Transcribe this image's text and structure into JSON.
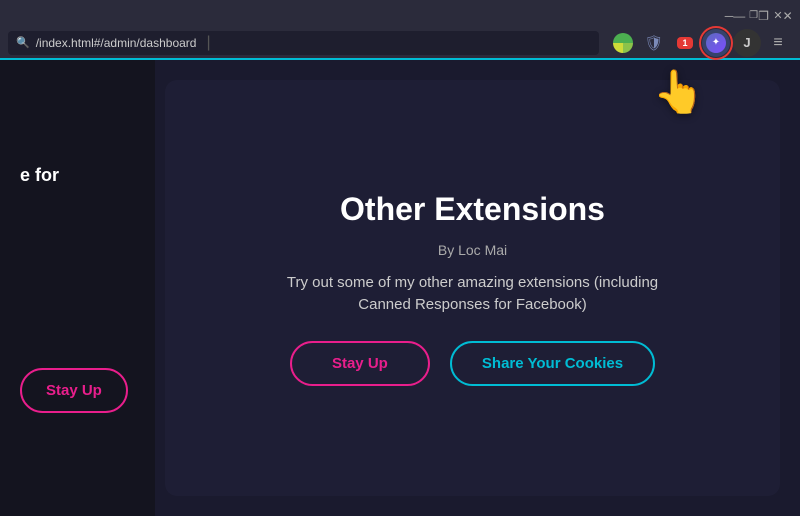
{
  "browser": {
    "address": "/index.html#/admin/dashboard",
    "window_controls": {
      "minimize": "—",
      "restore": "❐",
      "close": "✕"
    },
    "toolbar_icons": {
      "search_separator": "|",
      "shield": "🛡",
      "notification_count": "1",
      "ext_bitwarden_letter": "",
      "ext_active_letter": "",
      "ext_j": "J",
      "menu": "≡"
    }
  },
  "left_panel": {
    "partial_text": "e for"
  },
  "main_card": {
    "title": "Other Extensions",
    "author": "By Loc Mai",
    "description": "Try out some of my other amazing extensions (including Canned Responses for Facebook)",
    "buttons": {
      "stay_up": "Stay Up",
      "share_cookies": "Share Your Cookies"
    }
  }
}
